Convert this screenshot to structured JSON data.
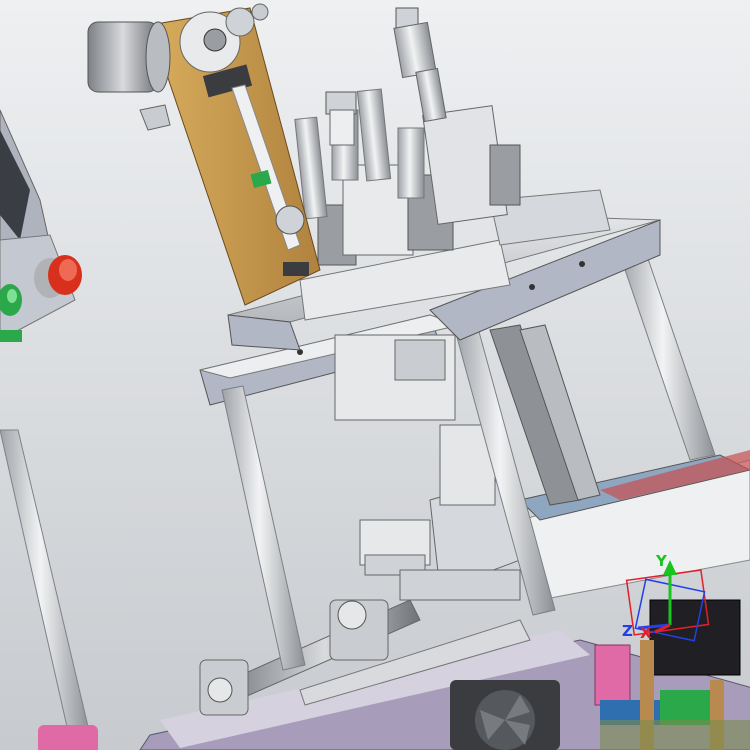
{
  "scene": {
    "subject": "cad-assembly-render",
    "background_top": "#eef0f2",
    "background_bottom": "#c7cace"
  },
  "triad": {
    "x_label": "X",
    "y_label": "Y",
    "z_label": "Z",
    "x_color": "#e0202a",
    "y_color": "#19c41f",
    "z_color": "#2340e8"
  },
  "colors": {
    "bracket": "#c89b4e",
    "steel": "#c9ccd0",
    "steel_dark": "#8e9297",
    "panel_blue": "#aeb4c4",
    "deck_purple": "#8a78a8",
    "pink": "#e06aa6",
    "green_btn": "#2aa84a",
    "red_btn": "#d9301e",
    "wood": "#b98a4f"
  }
}
